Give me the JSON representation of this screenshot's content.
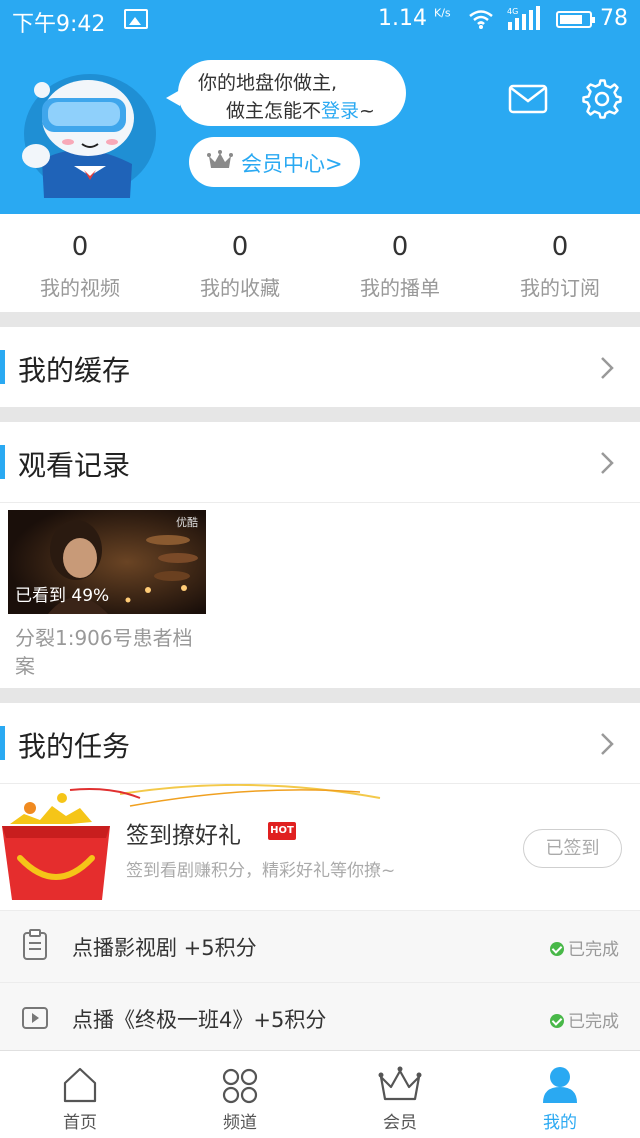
{
  "status_bar": {
    "time": "下午9:42",
    "speed": "1.14",
    "speed_unit": "K/s",
    "network": "4G",
    "battery": "78"
  },
  "header": {
    "bubble_line1": "你的地盘你做主,",
    "bubble_line2_prefix": "做主怎能不",
    "bubble_login": "登录",
    "bubble_suffix": "~",
    "member_center": "会员中心>"
  },
  "stats": [
    {
      "count": "0",
      "label": "我的视频"
    },
    {
      "count": "0",
      "label": "我的收藏"
    },
    {
      "count": "0",
      "label": "我的播单"
    },
    {
      "count": "0",
      "label": "我的订阅"
    }
  ],
  "sections": {
    "cache": "我的缓存",
    "history": "观看记录",
    "tasks": "我的任务"
  },
  "history": {
    "watermark": "优酷",
    "progress": "已看到 49%",
    "title": "分裂1:906号患者档案"
  },
  "signin": {
    "title": "签到撩好礼",
    "badge": "HOT",
    "desc": "签到看剧赚积分，精彩好礼等你撩~",
    "button": "已签到"
  },
  "tasks": [
    {
      "label": "点播影视剧 +5积分",
      "status": "已完成",
      "icon": "clipboard-icon"
    },
    {
      "label": "点播《终极一班4》+5积分",
      "status": "已完成",
      "icon": "play-icon"
    }
  ],
  "bottom_nav": [
    {
      "label": "首页",
      "icon": "home-icon"
    },
    {
      "label": "频道",
      "icon": "grid-icon"
    },
    {
      "label": "会员",
      "icon": "crown-icon"
    },
    {
      "label": "我的",
      "icon": "person-icon",
      "active": true
    }
  ],
  "colors": {
    "accent": "#2aa9f2",
    "header_bg": "#2aa9f2",
    "complete": "#48b848",
    "hot": "#e02020"
  }
}
